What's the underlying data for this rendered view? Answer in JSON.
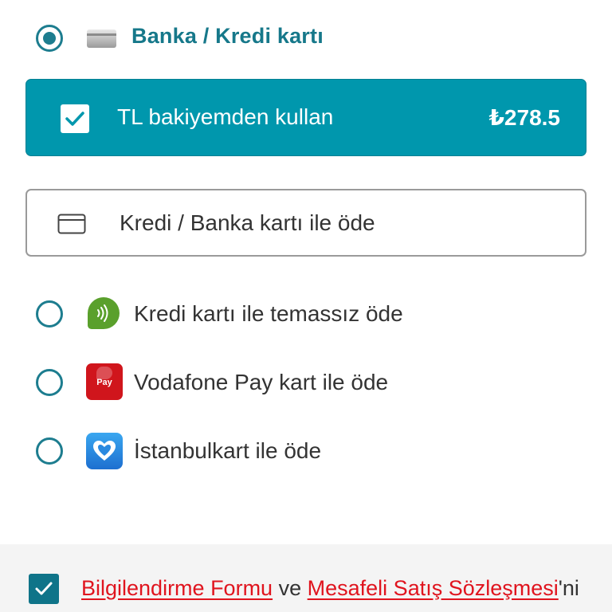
{
  "header": {
    "option_label": "Banka / Kredi kartı",
    "selected": true
  },
  "balance": {
    "label": "TL bakiyemden kullan",
    "amount": "₺278.5",
    "checked": true,
    "color": "#0097ad"
  },
  "card_payment": {
    "label": "Kredi / Banka kartı ile öde"
  },
  "options": [
    {
      "label": "Kredi kartı ile temassız öde",
      "icon": "contactless-icon",
      "selected": false
    },
    {
      "label": "Vodafone Pay kart ile öde",
      "icon": "vodafone-pay-icon",
      "icon_text": "Pay",
      "selected": false
    },
    {
      "label": "İstanbulkart ile öde",
      "icon": "istanbulkart-icon",
      "selected": false
    }
  ],
  "agreement": {
    "link1": "Bilgilendirme Formu",
    "connector": "ve",
    "link2": "Mesafeli Satış Sözleşmesi",
    "suffix": "'ni",
    "checked": true
  },
  "colors": {
    "brand_teal": "#16788a",
    "link_red": "#e0141e"
  }
}
